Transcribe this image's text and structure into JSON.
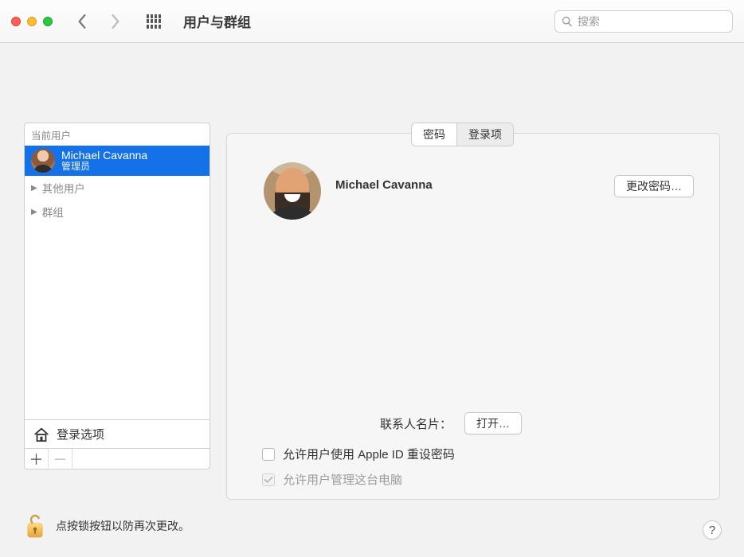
{
  "window": {
    "title": "用户与群组"
  },
  "search": {
    "placeholder": "搜索"
  },
  "sidebar": {
    "current_user_header": "当前用户",
    "selected_user": {
      "name": "Michael Cavanna",
      "role": "管理员"
    },
    "rows": {
      "other_users": "其他用户",
      "groups": "群组"
    },
    "login_options": "登录选项"
  },
  "tabs": {
    "password": "密码",
    "login_items": "登录项",
    "active": "password"
  },
  "panel": {
    "user_name": "Michael Cavanna",
    "change_password_btn": "更改密码…",
    "contacts_label": "联系人名片：",
    "open_btn": "打开…",
    "checkbox_apple_id": {
      "label": "允许用户使用 Apple ID 重设密码",
      "checked": false,
      "enabled": true
    },
    "checkbox_admin": {
      "label": "允许用户管理这台电脑",
      "checked": true,
      "enabled": false
    }
  },
  "footer": {
    "lock_text": "点按锁按钮以防再次更改。"
  }
}
